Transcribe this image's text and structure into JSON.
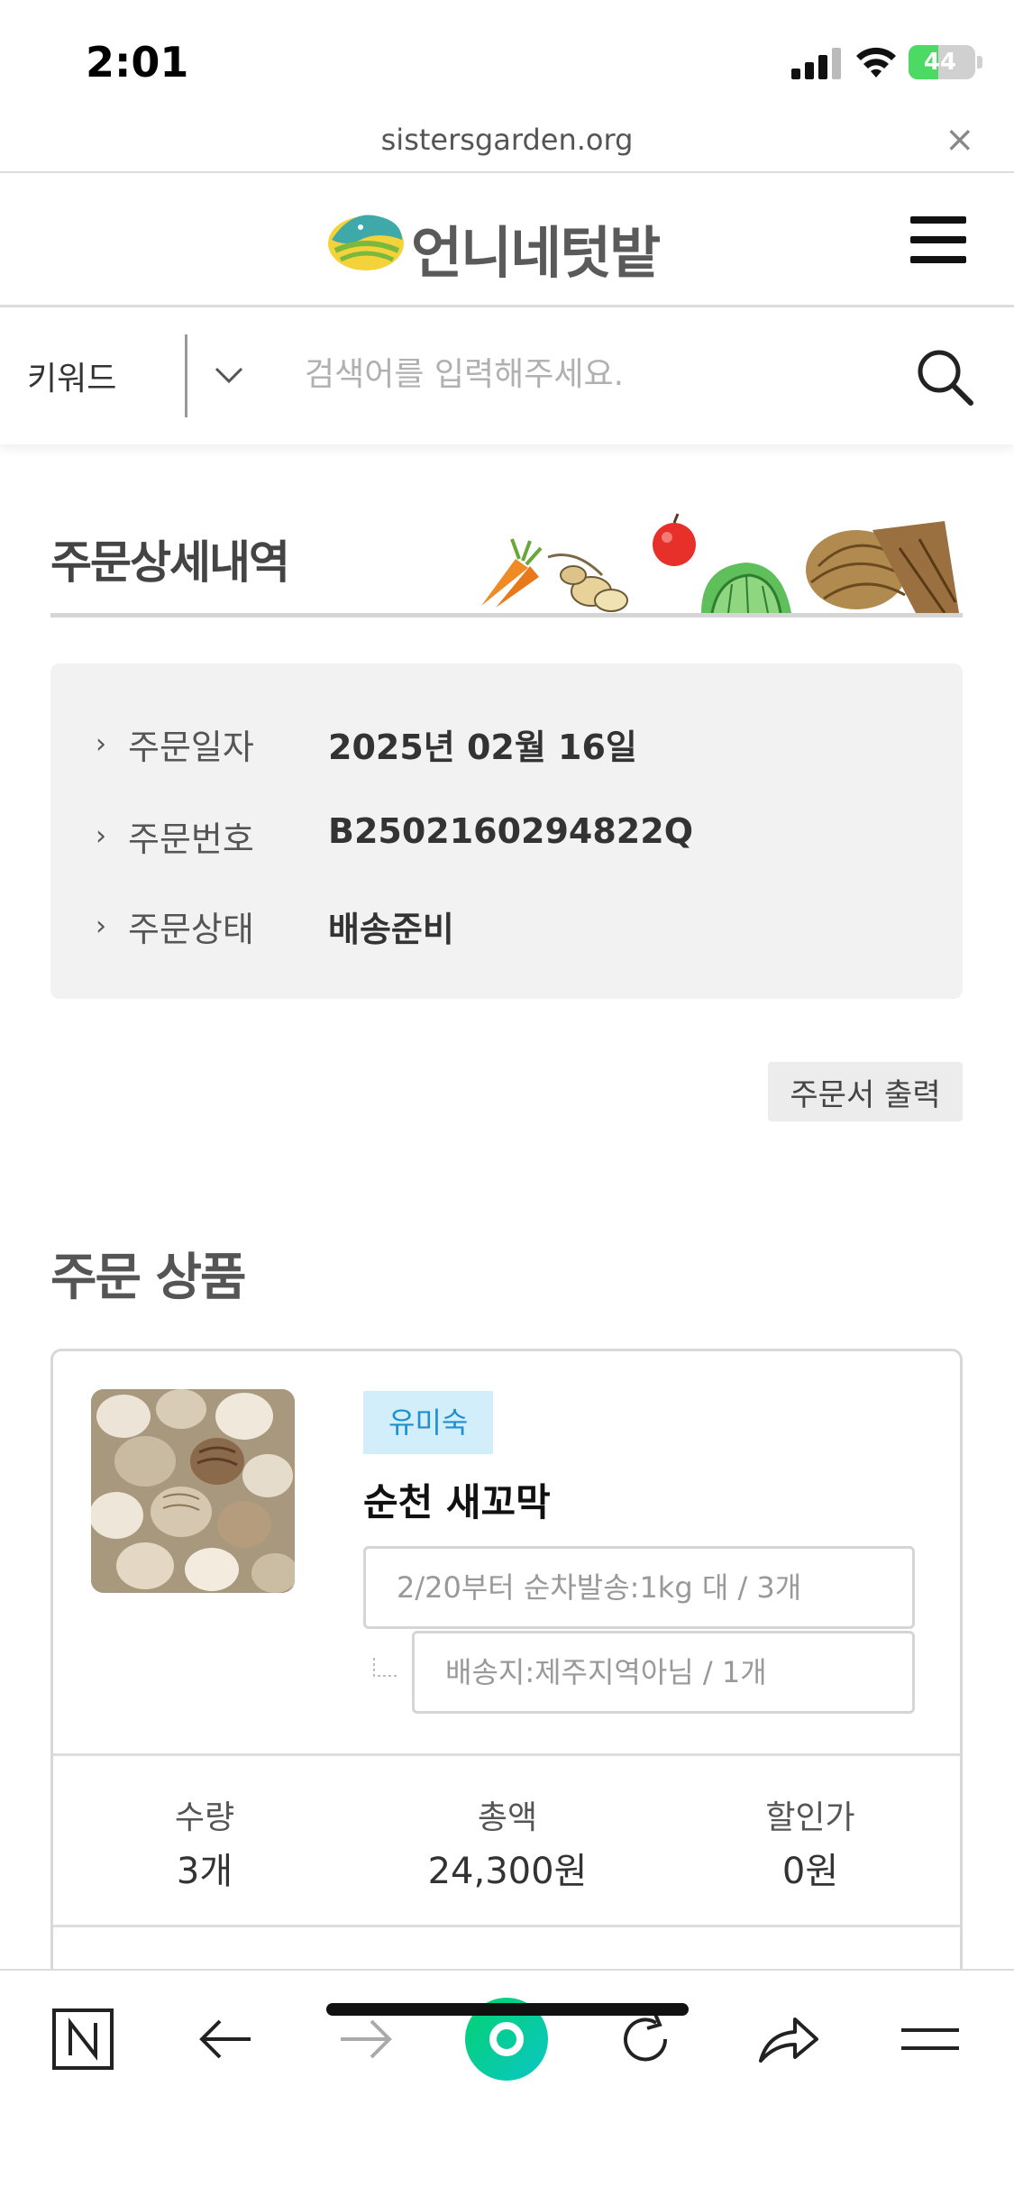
{
  "status_bar": {
    "time": "2:01",
    "battery": "44",
    "battery_percent": 44,
    "battery_color": "#4cd964"
  },
  "browser": {
    "url": "sistersgarden.org",
    "close_icon": "×"
  },
  "header": {
    "logo_text": "언니네텃밭",
    "menu_icon": "hamburger-menu-icon"
  },
  "search": {
    "category": "키워드",
    "placeholder": "검색어를 입력해주세요."
  },
  "order_detail": {
    "title": "주문상세내역",
    "rows": [
      {
        "label": "주문일자",
        "value": "2025년 02월 16일"
      },
      {
        "label": "주문번호",
        "value": "B2502160294822Q"
      },
      {
        "label": "주문상태",
        "value": "배송준비"
      }
    ],
    "print_button": "주문서 출력"
  },
  "order_items": {
    "title": "주문 상품",
    "product": {
      "seller": "유미숙",
      "name": "순천 새꼬막",
      "option_main": "2/20부터 순차발송:1kg 대 / 3개",
      "option_sub": "배송지:제주지역아님 / 1개",
      "stats": [
        {
          "label": "수량",
          "value": "3개"
        },
        {
          "label": "총액",
          "value": "24,300원"
        },
        {
          "label": "할인가",
          "value": "0원"
        }
      ]
    }
  },
  "colors": {
    "seller_badge_bg": "#d3eefb",
    "seller_badge_text": "#1e8fd0",
    "info_box_bg": "#f2f2f2",
    "naver_green": "#03d26f"
  }
}
